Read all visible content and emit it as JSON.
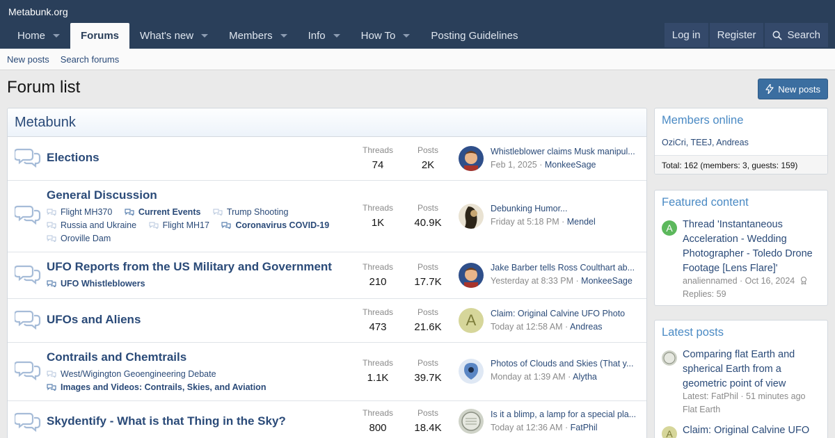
{
  "site": {
    "title": "Metabunk.org"
  },
  "nav": {
    "items": [
      {
        "label": "Home",
        "caret": true,
        "active": false
      },
      {
        "label": "Forums",
        "caret": false,
        "active": true
      },
      {
        "label": "What's new",
        "caret": true,
        "active": false
      },
      {
        "label": "Members",
        "caret": true,
        "active": false
      },
      {
        "label": "Info",
        "caret": true,
        "active": false
      },
      {
        "label": "How To",
        "caret": true,
        "active": false
      },
      {
        "label": "Posting Guidelines",
        "caret": false,
        "active": false
      }
    ],
    "login": "Log in",
    "register": "Register",
    "search": "Search"
  },
  "subnav": {
    "new_posts": "New posts",
    "search_forums": "Search forums"
  },
  "page": {
    "title": "Forum list",
    "new_posts_button": "New posts"
  },
  "block": {
    "title": "Metabunk",
    "threads_label": "Threads",
    "posts_label": "Posts",
    "forums": [
      {
        "title": "Elections",
        "threads": "74",
        "posts": "2K",
        "latest_title": "Whistleblower claims Musk manipul...",
        "latest_date": "Feb 1, 2025",
        "latest_user": "MonkeeSage",
        "subforums": []
      },
      {
        "title": "General Discussion",
        "threads": "1K",
        "posts": "40.9K",
        "latest_title": "Debunking Humor...",
        "latest_date": "Friday at 5:18 PM",
        "latest_user": "Mendel",
        "subforums": [
          {
            "label": "Flight MH370",
            "bold": false
          },
          {
            "label": "Current Events",
            "bold": true
          },
          {
            "label": "Trump Shooting",
            "bold": false
          },
          {
            "label": "Russia and Ukraine",
            "bold": false
          },
          {
            "label": "Flight MH17",
            "bold": false
          },
          {
            "label": "Coronavirus COVID-19",
            "bold": true
          },
          {
            "label": "Oroville Dam",
            "bold": false
          }
        ]
      },
      {
        "title": "UFO Reports from the US Military and Government",
        "threads": "210",
        "posts": "17.7K",
        "latest_title": "Jake Barber tells Ross Coulthart ab...",
        "latest_date": "Yesterday at 8:33 PM",
        "latest_user": "MonkeeSage",
        "subforums": [
          {
            "label": "UFO Whistleblowers",
            "bold": true
          }
        ]
      },
      {
        "title": "UFOs and Aliens",
        "threads": "473",
        "posts": "21.6K",
        "latest_title": "Claim: Original Calvine UFO Photo",
        "latest_date": "Today at 12:58 AM",
        "latest_user": "Andreas",
        "avatar_letter": "A",
        "subforums": []
      },
      {
        "title": "Contrails and Chemtrails",
        "threads": "1.1K",
        "posts": "39.7K",
        "latest_title": "Photos of Clouds and Skies (That y...",
        "latest_date": "Monday at 1:39 AM",
        "latest_user": "Alytha",
        "subforums": [
          {
            "label": "West/Wigington Geoengineering Debate",
            "bold": false
          },
          {
            "label": "Images and Videos: Contrails, Skies, and Aviation",
            "bold": true
          }
        ]
      },
      {
        "title": "Skydentify - What is that Thing in the Sky?",
        "threads": "800",
        "posts": "18.4K",
        "latest_title": "Is it a blimp, a lamp for a special pla...",
        "latest_date": "Today at 12:36 AM",
        "latest_user": "FatPhil",
        "subforums": []
      }
    ]
  },
  "sidebar": {
    "members_online": {
      "title": "Members online",
      "members": [
        "OziCri",
        "TEEJ",
        "Andreas"
      ],
      "total": "Total: 162 (members: 3, guests: 159)"
    },
    "featured": {
      "title": "Featured content",
      "avatar_letter": "A",
      "text": "Thread 'Instantaneous Acceleration - Wedding Photographer - Toledo Drone Footage [Lens Flare]'",
      "meta_user": "analiennamed",
      "meta_date": "Oct 16, 2024",
      "replies": "Replies: 59"
    },
    "latest": {
      "title": "Latest posts",
      "post1_title": "Comparing flat Earth and spherical Earth from a geometric point of view",
      "post1_meta": "Latest: FatPhil · 51 minutes ago",
      "post1_forum": "Flat Earth",
      "post2_title": "Claim: Original Calvine UFO",
      "post2_letter": "A"
    }
  },
  "colors": {
    "header": "#2a3f5a",
    "link": "#2a4a78",
    "accent": "#3b6ea0",
    "green_avatar": "#5cb85c"
  }
}
